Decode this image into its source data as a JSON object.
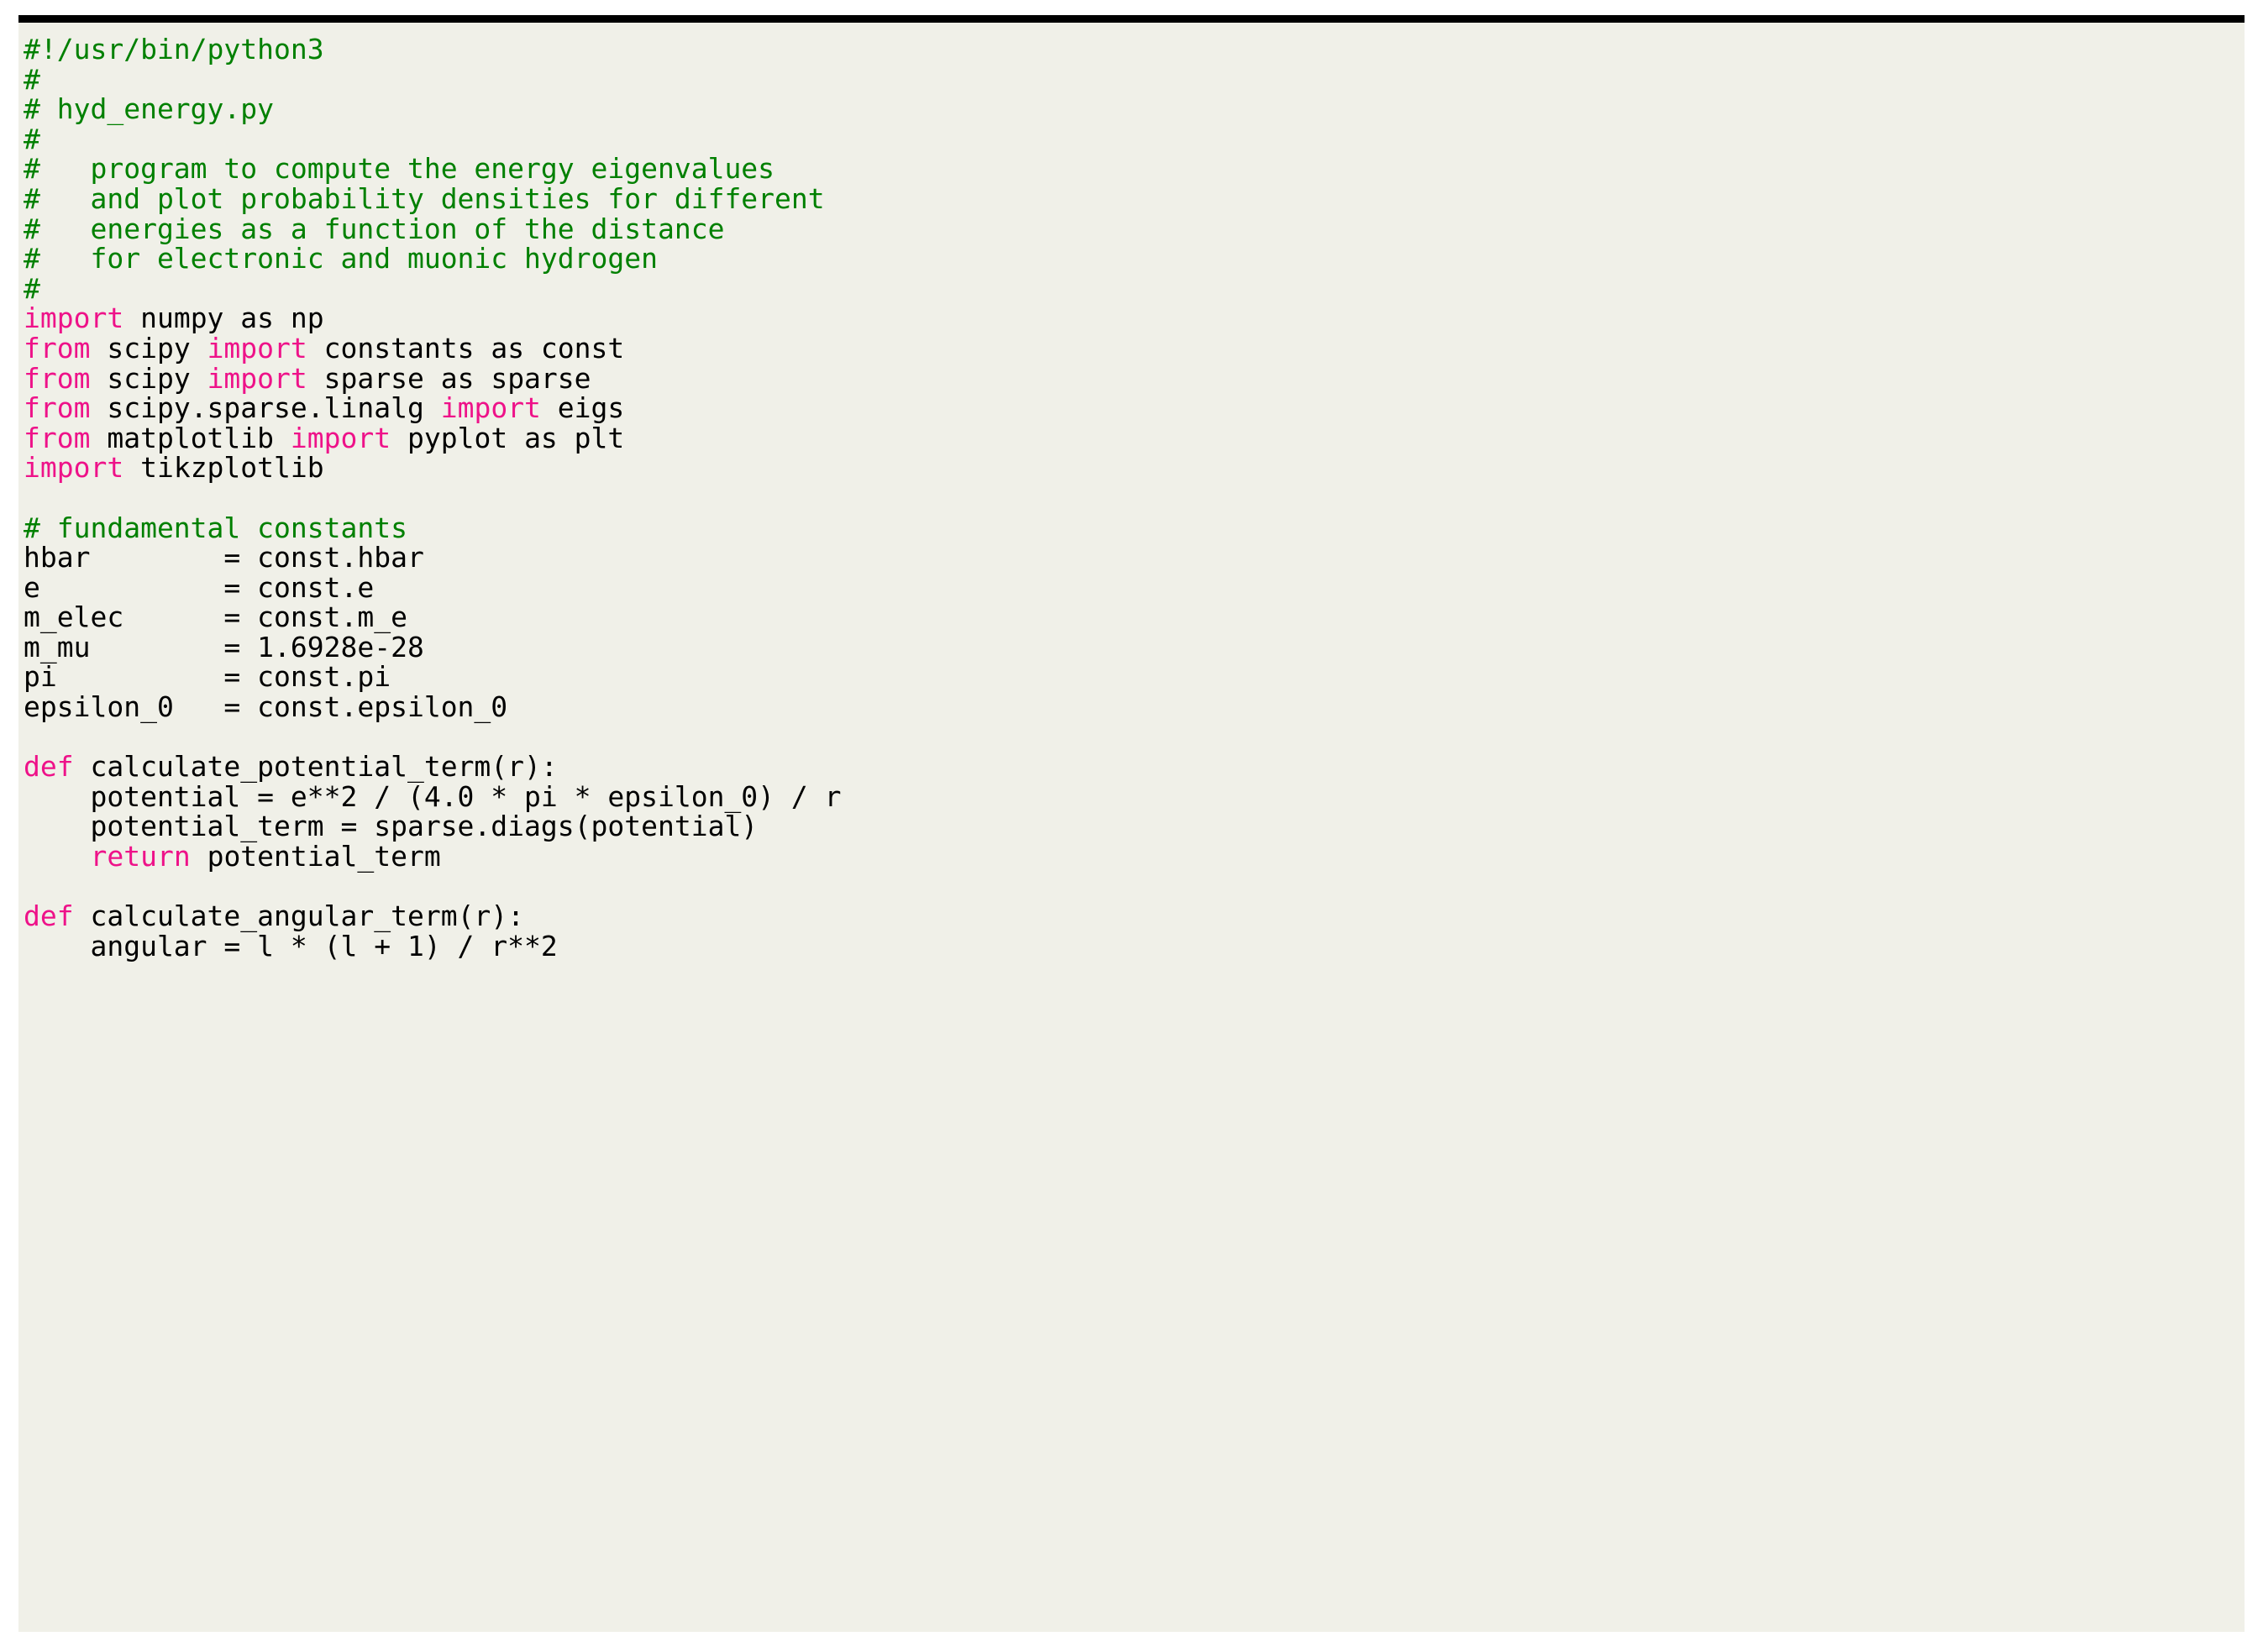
{
  "document": {
    "kind": "code-listing",
    "language": "python",
    "filename": "hyd_energy.py",
    "background_color": "#f0f0e8",
    "page_background": "#ffffff",
    "rule_color": "#000000",
    "colors": {
      "comment": "#008000",
      "keyword": "#ee1289",
      "text": "#000000"
    }
  },
  "code": {
    "lines": [
      {
        "id": "l01",
        "tokens": [
          {
            "t": "comment",
            "s": "#!/usr/bin/python3"
          }
        ]
      },
      {
        "id": "l02",
        "tokens": [
          {
            "t": "comment",
            "s": "#"
          }
        ]
      },
      {
        "id": "l03",
        "tokens": [
          {
            "t": "comment",
            "s": "# hyd_energy.py"
          }
        ]
      },
      {
        "id": "l04",
        "tokens": [
          {
            "t": "comment",
            "s": "#"
          }
        ]
      },
      {
        "id": "l05",
        "tokens": [
          {
            "t": "comment",
            "s": "#   program to compute the energy eigenvalues"
          }
        ]
      },
      {
        "id": "l06",
        "tokens": [
          {
            "t": "comment",
            "s": "#   and plot probability densities for different"
          }
        ]
      },
      {
        "id": "l07",
        "tokens": [
          {
            "t": "comment",
            "s": "#   energies as a function of the distance"
          }
        ]
      },
      {
        "id": "l08",
        "tokens": [
          {
            "t": "comment",
            "s": "#   for electronic and muonic hydrogen"
          }
        ]
      },
      {
        "id": "l09",
        "tokens": [
          {
            "t": "comment",
            "s": "#"
          }
        ]
      },
      {
        "id": "l10",
        "tokens": [
          {
            "t": "keyword",
            "s": "import"
          },
          {
            "t": "text",
            "s": " numpy as np"
          }
        ]
      },
      {
        "id": "l11",
        "tokens": [
          {
            "t": "keyword",
            "s": "from"
          },
          {
            "t": "text",
            "s": " scipy "
          },
          {
            "t": "keyword",
            "s": "import"
          },
          {
            "t": "text",
            "s": " constants as const"
          }
        ]
      },
      {
        "id": "l12",
        "tokens": [
          {
            "t": "keyword",
            "s": "from"
          },
          {
            "t": "text",
            "s": " scipy "
          },
          {
            "t": "keyword",
            "s": "import"
          },
          {
            "t": "text",
            "s": " sparse as sparse"
          }
        ]
      },
      {
        "id": "l13",
        "tokens": [
          {
            "t": "keyword",
            "s": "from"
          },
          {
            "t": "text",
            "s": " scipy.sparse.linalg "
          },
          {
            "t": "keyword",
            "s": "import"
          },
          {
            "t": "text",
            "s": " eigs"
          }
        ]
      },
      {
        "id": "l14",
        "tokens": [
          {
            "t": "keyword",
            "s": "from"
          },
          {
            "t": "text",
            "s": " matplotlib "
          },
          {
            "t": "keyword",
            "s": "import"
          },
          {
            "t": "text",
            "s": " pyplot as plt"
          }
        ]
      },
      {
        "id": "l15",
        "tokens": [
          {
            "t": "keyword",
            "s": "import"
          },
          {
            "t": "text",
            "s": " tikzplotlib"
          }
        ]
      },
      {
        "id": "l16",
        "tokens": []
      },
      {
        "id": "l17",
        "tokens": [
          {
            "t": "comment",
            "s": "# fundamental constants"
          }
        ]
      },
      {
        "id": "l18",
        "tokens": [
          {
            "t": "text",
            "s": "hbar        = const.hbar"
          }
        ]
      },
      {
        "id": "l19",
        "tokens": [
          {
            "t": "text",
            "s": "e           = const.e"
          }
        ]
      },
      {
        "id": "l20",
        "tokens": [
          {
            "t": "text",
            "s": "m_elec      = const.m_e"
          }
        ]
      },
      {
        "id": "l21",
        "tokens": [
          {
            "t": "text",
            "s": "m_mu        = 1.6928e-28"
          }
        ]
      },
      {
        "id": "l22",
        "tokens": [
          {
            "t": "text",
            "s": "pi          = const.pi"
          }
        ]
      },
      {
        "id": "l23",
        "tokens": [
          {
            "t": "text",
            "s": "epsilon_0   = const.epsilon_0"
          }
        ]
      },
      {
        "id": "l24",
        "tokens": []
      },
      {
        "id": "l25",
        "tokens": [
          {
            "t": "keyword",
            "s": "def"
          },
          {
            "t": "text",
            "s": " calculate_potential_term(r):"
          }
        ]
      },
      {
        "id": "l26",
        "tokens": [
          {
            "t": "text",
            "s": "    potential = e**2 / (4.0 * pi * epsilon_0) / r"
          }
        ]
      },
      {
        "id": "l27",
        "tokens": [
          {
            "t": "text",
            "s": "    potential_term = sparse.diags(potential)"
          }
        ]
      },
      {
        "id": "l28",
        "tokens": [
          {
            "t": "text",
            "s": "    "
          },
          {
            "t": "keyword",
            "s": "return"
          },
          {
            "t": "text",
            "s": " potential_term"
          }
        ]
      },
      {
        "id": "l29",
        "tokens": []
      },
      {
        "id": "l30",
        "tokens": [
          {
            "t": "keyword",
            "s": "def"
          },
          {
            "t": "text",
            "s": " calculate_angular_term(r):"
          }
        ]
      },
      {
        "id": "l31",
        "tokens": [
          {
            "t": "text",
            "s": "    angular = l * (l + 1) / r**2"
          }
        ]
      }
    ]
  }
}
